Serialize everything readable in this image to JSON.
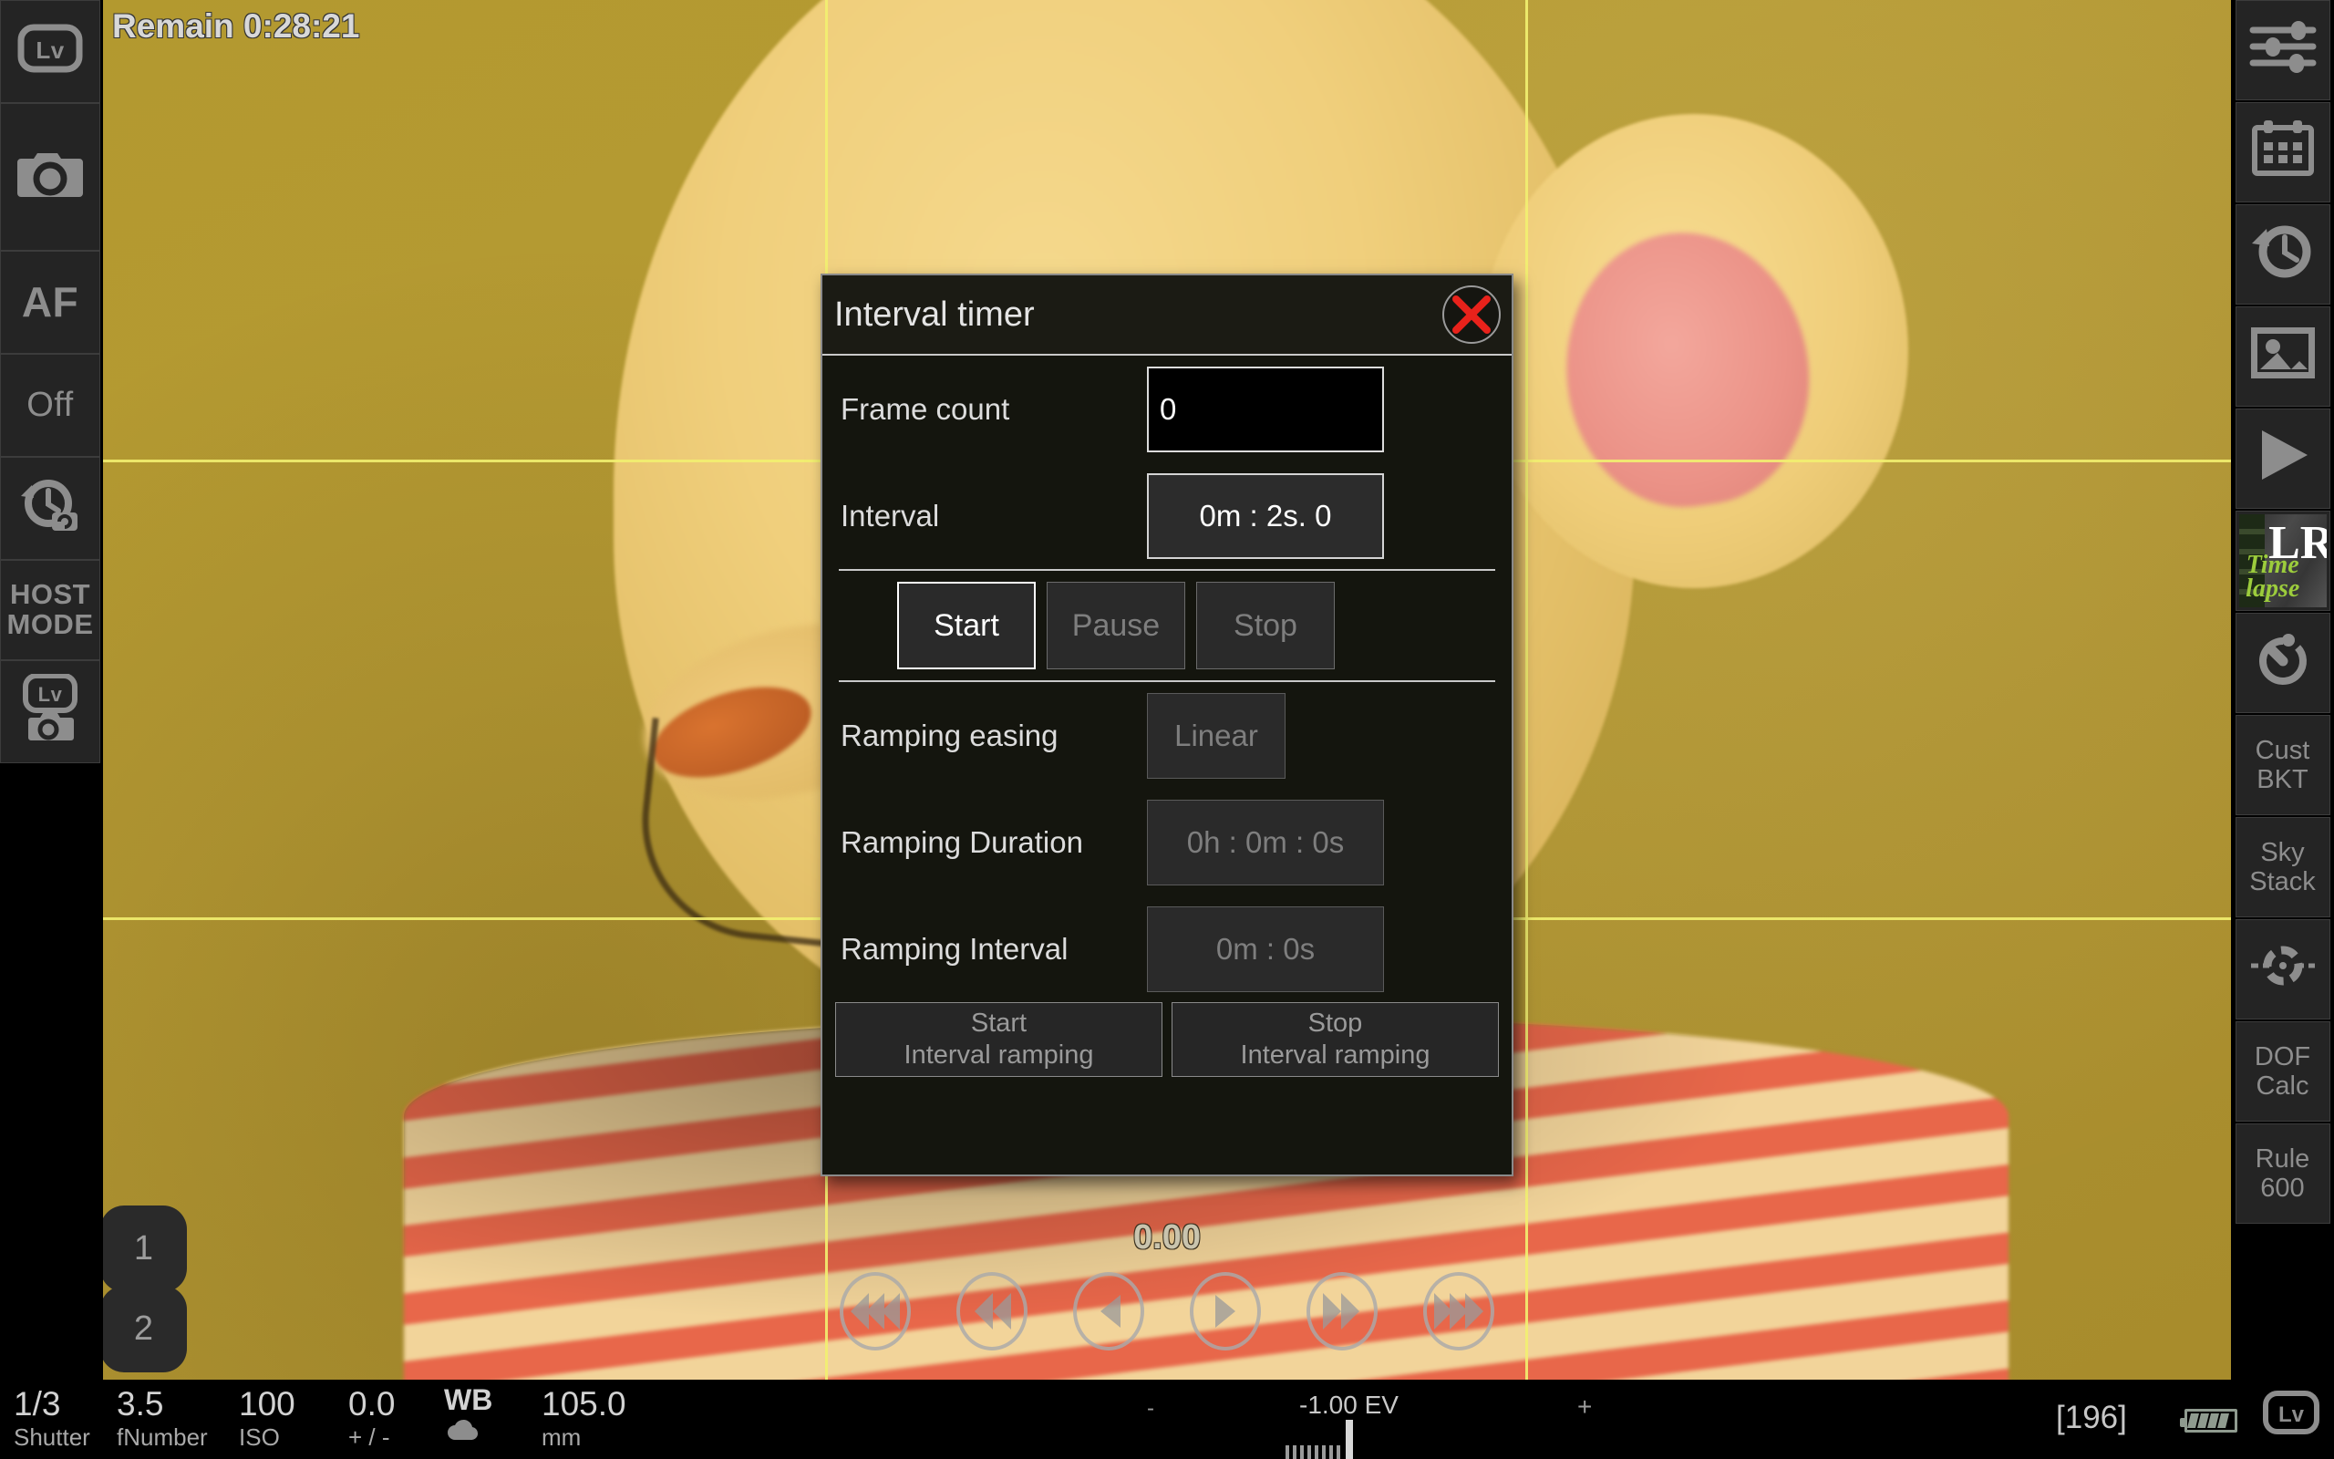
{
  "app": {
    "viewfinder": {
      "remaining_label": "Remain 0:28:21",
      "focus_value": "0.00",
      "preset_buttons": [
        "1",
        "2"
      ],
      "focus_controls": [
        "focus-far-fast-icon",
        "focus-far-medium-icon",
        "focus-far-slow-icon",
        "focus-near-slow-icon",
        "focus-near-medium-icon",
        "focus-near-fast-icon"
      ]
    }
  },
  "left_toolbar": {
    "items": [
      {
        "name": "live-view-toggle",
        "label": "Lv",
        "icon": "live-view-icon"
      },
      {
        "name": "shutter-release",
        "label": "",
        "icon": "camera-icon"
      },
      {
        "name": "autofocus-toggle",
        "label": "AF",
        "icon": "af-text-icon"
      },
      {
        "name": "drive-mode",
        "label": "Off",
        "icon": "off-text-icon"
      },
      {
        "name": "interval-timer",
        "label": "",
        "icon": "interval-timer-icon"
      },
      {
        "name": "host-mode",
        "label": "HOST\nMODE",
        "icon": "host-mode-icon"
      },
      {
        "name": "live-view-capture",
        "label": "",
        "icon": "live-view-camera-icon"
      }
    ]
  },
  "right_toolbar": {
    "items": [
      {
        "name": "settings-sliders",
        "label": "",
        "icon": "sliders-icon"
      },
      {
        "name": "calendar",
        "label": "",
        "icon": "calendar-icon"
      },
      {
        "name": "timer-history",
        "label": "",
        "icon": "clock-rewind-icon"
      },
      {
        "name": "gallery",
        "label": "",
        "icon": "image-icon"
      },
      {
        "name": "play",
        "label": "",
        "icon": "play-icon"
      },
      {
        "name": "lr-timelapse",
        "label": "LR Timelapse",
        "icon": "lr-timelapse-icon"
      },
      {
        "name": "stopwatch",
        "label": "",
        "icon": "stopwatch-icon"
      },
      {
        "name": "custom-bracketing",
        "label": "Cust\nBKT",
        "icon": "cust-bkt-text-icon"
      },
      {
        "name": "sky-stack",
        "label": "Sky\nStack",
        "icon": "sky-stack-text-icon"
      },
      {
        "name": "star-tracker",
        "label": "",
        "icon": "crosshair-icon"
      },
      {
        "name": "dof-calculator",
        "label": "DOF\nCalc",
        "icon": "dof-calc-text-icon"
      },
      {
        "name": "rule-600",
        "label": "Rule\n600",
        "icon": "rule-600-text-icon"
      }
    ]
  },
  "dialog": {
    "title": "Interval timer",
    "close_icon": "close-x-icon",
    "frame_count": {
      "label": "Frame count",
      "value": "0"
    },
    "interval": {
      "label": "Interval",
      "value": "0m : 2s. 0"
    },
    "transport": {
      "start": {
        "label": "Start",
        "enabled": true
      },
      "pause": {
        "label": "Pause",
        "enabled": false
      },
      "stop": {
        "label": "Stop",
        "enabled": false
      }
    },
    "ramping_easing": {
      "label": "Ramping easing",
      "value": "Linear"
    },
    "ramping_duration": {
      "label": "Ramping Duration",
      "value": "0h : 0m : 0s"
    },
    "ramping_interval": {
      "label": "Ramping Interval",
      "value": "0m : 0s"
    },
    "ramping_buttons": {
      "start": {
        "line1": "Start",
        "line2": "Interval ramping"
      },
      "stop": {
        "line1": "Stop",
        "line2": "Interval ramping"
      }
    }
  },
  "status_bar": {
    "shutter": {
      "value": "1/3",
      "label": "Shutter"
    },
    "fnumber": {
      "value": "3.5",
      "label": "fNumber"
    },
    "iso": {
      "value": "100",
      "label": "ISO"
    },
    "exp_comp": {
      "value": "0.0",
      "label": "+ / -"
    },
    "wb": {
      "value": "WB",
      "label": "cloudy-wb-icon"
    },
    "focal": {
      "value": "105.0",
      "label": "mm"
    },
    "ev": {
      "minus": "-",
      "plus": "+",
      "value": "-1.00 EV"
    },
    "shots_remaining": "[196]",
    "battery_icon": "battery-full-icon",
    "live_view_icon": "Lv"
  },
  "colors": {
    "accent_grid": "#f2ef70",
    "close_red": "#e8221b",
    "panel_bg": "#242424",
    "icon_gray": "#8d8d8d",
    "timelapse_green": "#9ccc3c"
  }
}
